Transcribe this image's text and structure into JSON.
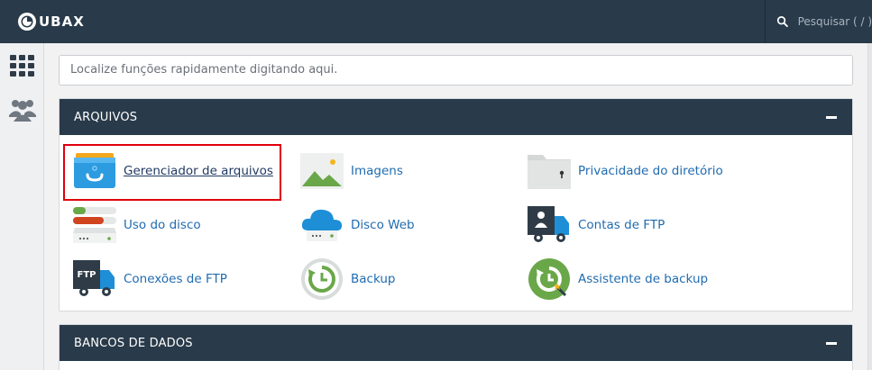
{
  "brand": {
    "name": "UBAX"
  },
  "topbar": {
    "search_placeholder": "Pesquisar ( / )"
  },
  "quick_search": {
    "placeholder": "Localize funções rapidamente digitando aqui."
  },
  "sections": [
    {
      "title": "ARQUIVOS",
      "items": [
        {
          "label": "Gerenciador de arquivos",
          "icon": "file-manager-icon"
        },
        {
          "label": "Imagens",
          "icon": "images-icon"
        },
        {
          "label": "Privacidade do diretório",
          "icon": "directory-privacy-icon"
        },
        {
          "label": "Uso do disco",
          "icon": "disk-usage-icon"
        },
        {
          "label": "Disco Web",
          "icon": "web-disk-icon"
        },
        {
          "label": "Contas de FTP",
          "icon": "ftp-accounts-icon"
        },
        {
          "label": "Conexões de FTP",
          "icon": "ftp-connections-icon"
        },
        {
          "label": "Backup",
          "icon": "backup-icon"
        },
        {
          "label": "Assistente de backup",
          "icon": "backup-wizard-icon"
        }
      ]
    },
    {
      "title": "BANCOS DE DADOS"
    }
  ],
  "icon_texts": {
    "ftp": "FTP"
  },
  "colors": {
    "topbar": "#293a4a",
    "link": "#1f6bb0",
    "highlight": "#e0000b"
  }
}
